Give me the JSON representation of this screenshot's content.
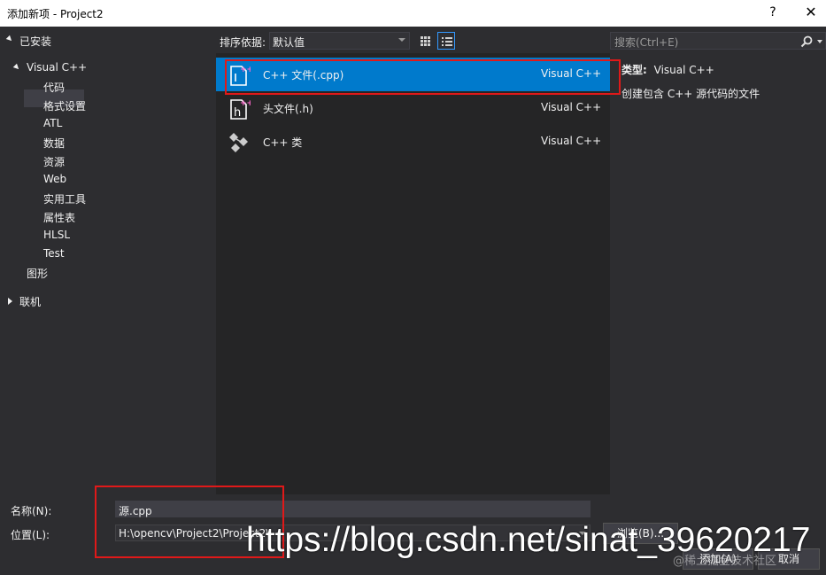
{
  "window": {
    "title": "添加新项 - Project2",
    "help_label": "?",
    "close_label": "✕"
  },
  "toolbar": {
    "sort_label": "排序依据:",
    "sort_value": "默认值",
    "search_placeholder": "搜索(Ctrl+E)"
  },
  "tree": {
    "installed": "已安装",
    "visual_cpp": "Visual C++",
    "children": [
      "代码",
      "格式设置",
      "ATL",
      "数据",
      "资源",
      "Web",
      "实用工具",
      "属性表",
      "HLSL",
      "Test"
    ],
    "graphics": "图形",
    "online": "联机"
  },
  "templates": [
    {
      "name": "C++ 文件(.cpp)",
      "type": "Visual C++",
      "icon": "cpp-file-icon",
      "selected": true
    },
    {
      "name": "头文件(.h)",
      "type": "Visual C++",
      "icon": "header-file-icon",
      "selected": false
    },
    {
      "name": "C++ 类",
      "type": "Visual C++",
      "icon": "cpp-class-icon",
      "selected": false
    }
  ],
  "info": {
    "type_label": "类型:",
    "type_value": "Visual C++",
    "description": "创建包含 C++ 源代码的文件"
  },
  "form": {
    "name_label": "名称(N):",
    "name_value": "源.cpp",
    "location_label": "位置(L):",
    "location_value": "H:\\opencv\\Project2\\Project2\\",
    "browse_label": "浏览(B)...",
    "add_label": "添加(A)",
    "cancel_label": "取消"
  },
  "watermark": {
    "url": "https://blog.csdn.net/sinat_39620217",
    "corner": "@稀土掘金技术社区"
  },
  "colors": {
    "selection": "#007acc",
    "highlight": "#e01919"
  }
}
